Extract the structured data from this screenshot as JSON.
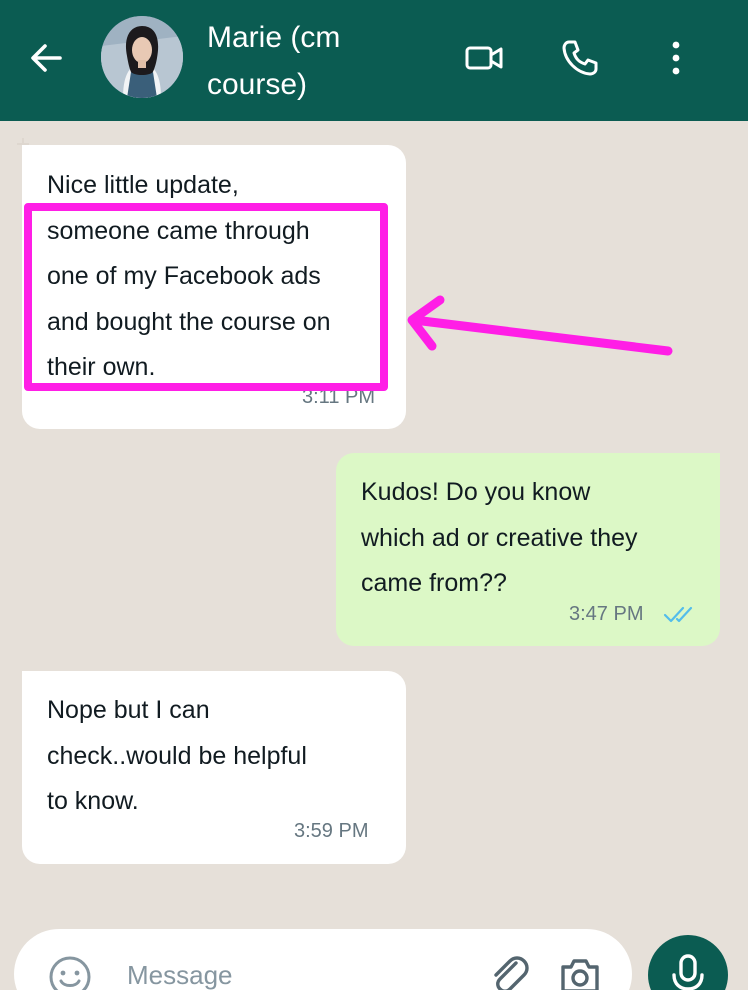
{
  "header": {
    "contact_name": "Marie (cm course)",
    "back_icon": "back-arrow-icon",
    "video_icon": "video-call-icon",
    "call_icon": "phone-call-icon",
    "menu_icon": "more-vert-icon",
    "bg_color": "#0b5c52"
  },
  "messages": [
    {
      "direction": "incoming",
      "text": "Nice little update,\nsomeone came through\none of my Facebook ads\nand bought the course on\ntheir own.",
      "time": "3:11 PM"
    },
    {
      "direction": "outgoing",
      "text": "Kudos! Do you know\nwhich ad or creative they\ncame from??",
      "time": "3:47 PM",
      "status_icon": "double-check-icon"
    },
    {
      "direction": "incoming",
      "text": "Nope but I can\ncheck..would be helpful\nto know.",
      "time": "3:59 PM"
    }
  ],
  "annotation": {
    "highlight_color": "#ff1ee6"
  },
  "composer": {
    "placeholder": "Message",
    "emoji_icon": "emoji-icon",
    "attach_icon": "paperclip-icon",
    "camera_icon": "camera-icon",
    "mic_icon": "mic-icon"
  }
}
